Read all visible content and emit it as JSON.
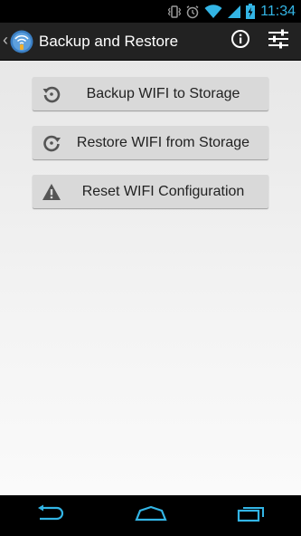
{
  "status_bar": {
    "time": "11:34",
    "icons": [
      "vibrate-icon",
      "alarm-icon",
      "wifi-icon",
      "signal-icon",
      "battery-charging-icon"
    ]
  },
  "action_bar": {
    "title": "Backup and Restore",
    "up_caret": "‹",
    "app_icon": "wifi-backup-app-icon",
    "actions": [
      "info-icon",
      "settings-sliders-icon"
    ]
  },
  "buttons": {
    "backup": {
      "label": "Backup WIFI to Storage",
      "icon": "backup-arrow-icon"
    },
    "restore": {
      "label": "Restore WIFI from Storage",
      "icon": "restore-arrow-icon"
    },
    "reset": {
      "label": "Reset WIFI Configuration",
      "icon": "warning-icon"
    }
  },
  "nav_bar": {
    "buttons": [
      "back-icon",
      "home-icon",
      "recent-apps-icon"
    ]
  },
  "colors": {
    "accent": "#33b5e5",
    "action_bar_bg": "#222222",
    "button_bg": "#d9d9d9"
  }
}
